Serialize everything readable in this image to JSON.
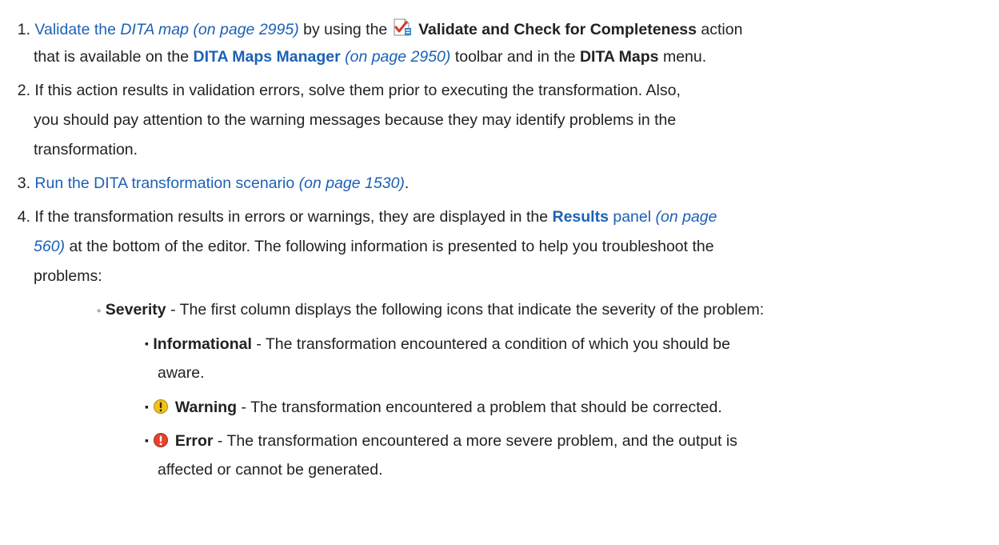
{
  "items": {
    "i1": {
      "num": "1.",
      "link": "Validate the",
      "link_em": "DITA map",
      "ref1": "(on page 2995)",
      "t1": "by using the",
      "action": "Validate and Check for Completeness",
      "t2": "action",
      "t3": "that is available on the",
      "dmm": "DITA Maps Manager",
      "ref2": "(on page 2950)",
      "t4": "toolbar and in the",
      "menu": "DITA Maps",
      "t5": "menu."
    },
    "i2": {
      "num": "2.",
      "l1": "If this action results in validation errors, solve them prior to executing the transformation. Also,",
      "l2": "you should pay attention to the warning messages because they may identify problems in the",
      "l3": "transformation."
    },
    "i3": {
      "num": "3.",
      "link": "Run the DITA transformation scenario",
      "ref": "(on page 1530)",
      "end": "."
    },
    "i4": {
      "num": "4.",
      "t1": "If the transformation results in errors or warnings, they are displayed in the",
      "results": "Results",
      "panel": "panel",
      "ref_a": "(on page",
      "ref_b": "560)",
      "t2": "at the bottom of the editor. The following information is presented to help you troubleshoot the",
      "t3": "problems:"
    },
    "severity": {
      "bullet": "◦",
      "label": "Severity",
      "text": "- The first column displays the following icons that indicate the severity of the problem:"
    },
    "levels": {
      "bullet": "▪",
      "info_label": "Informational",
      "info_l1": "- The transformation encountered a condition of which you should be",
      "info_l2": "aware.",
      "warn_label": "Warning",
      "warn_text": "- The transformation encountered a problem that should be corrected.",
      "err_label": "Error",
      "err_l1": "- The transformation encountered a more severe problem, and the output is",
      "err_l2": "affected or cannot be generated."
    }
  },
  "colors": {
    "link": "#1c61b6",
    "text": "#222222",
    "warning_icon": "#f2c21b",
    "error_icon": "#e5432b"
  },
  "icons": {
    "validate": "validate-check-icon",
    "warning": "warning-icon",
    "error": "error-icon"
  }
}
